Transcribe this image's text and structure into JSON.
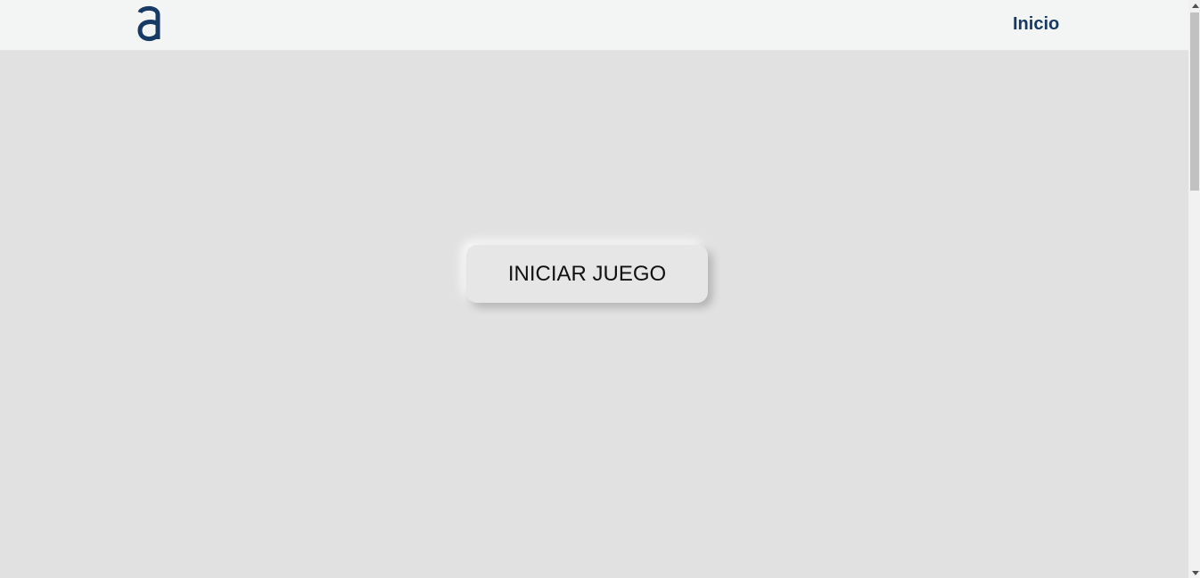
{
  "navbar": {
    "logo_icon": "a-letter-logo",
    "link_label": "Inicio"
  },
  "main": {
    "start_button_label": "INICIAR JUEGO"
  },
  "colors": {
    "brand": "#163a64",
    "background": "#e1e1e1",
    "navbar_background": "#f3f4f4",
    "button_background": "#e6e6e6"
  }
}
